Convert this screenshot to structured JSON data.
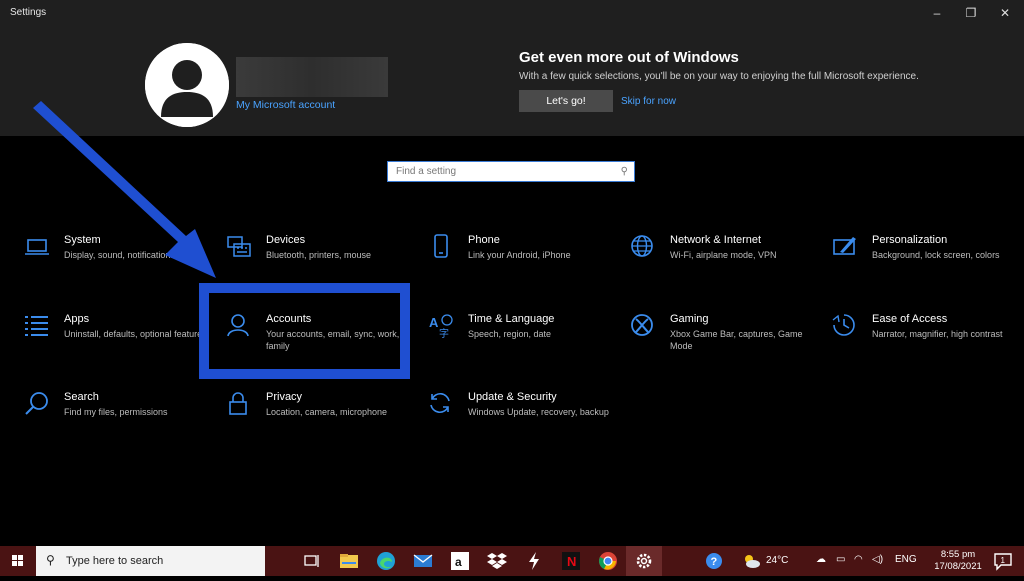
{
  "window": {
    "title": "Settings",
    "minimize_glyph": "–",
    "maximize_glyph": "❐",
    "close_glyph": "✕"
  },
  "account": {
    "link_label": "My Microsoft account"
  },
  "promo": {
    "title": "Get even more out of Windows",
    "subtitle": "With a few quick selections, you'll be on your way to enjoying the full Microsoft experience.",
    "primary_button": "Let's go!",
    "secondary_link": "Skip for now"
  },
  "search": {
    "placeholder": "Find a setting",
    "icon": "search-icon"
  },
  "accent_color": "#3b8ced",
  "highlight_color": "#1f4fd1",
  "tiles": [
    {
      "name": "System",
      "desc": "Display, sound, notifications, power",
      "icon": "laptop-icon"
    },
    {
      "name": "Devices",
      "desc": "Bluetooth, printers, mouse",
      "icon": "keyboard-icon"
    },
    {
      "name": "Phone",
      "desc": "Link your Android, iPhone",
      "icon": "phone-icon"
    },
    {
      "name": "Network & Internet",
      "desc": "Wi-Fi, airplane mode, VPN",
      "icon": "globe-icon"
    },
    {
      "name": "Personalization",
      "desc": "Background, lock screen, colors",
      "icon": "paint-icon"
    },
    {
      "name": "Apps",
      "desc": "Uninstall, defaults, optional features",
      "icon": "apps-list-icon"
    },
    {
      "name": "Accounts",
      "desc": "Your accounts, email, sync, work, family",
      "icon": "person-icon"
    },
    {
      "name": "Time & Language",
      "desc": "Speech, region, date",
      "icon": "time-language-icon"
    },
    {
      "name": "Gaming",
      "desc": "Xbox Game Bar, captures, Game Mode",
      "icon": "xbox-icon"
    },
    {
      "name": "Ease of Access",
      "desc": "Narrator, magnifier, high contrast",
      "icon": "ease-of-access-icon"
    },
    {
      "name": "Search",
      "desc": "Find my files, permissions",
      "icon": "search-icon"
    },
    {
      "name": "Privacy",
      "desc": "Location, camera, microphone",
      "icon": "lock-icon"
    },
    {
      "name": "Update & Security",
      "desc": "Windows Update, recovery, backup",
      "icon": "sync-icon"
    }
  ],
  "taskbar": {
    "search_placeholder": "Type here to search",
    "weather_temp": "24°C",
    "language": "ENG",
    "time": "8:55 pm",
    "date": "17/08/2021",
    "notification_count": "1"
  }
}
